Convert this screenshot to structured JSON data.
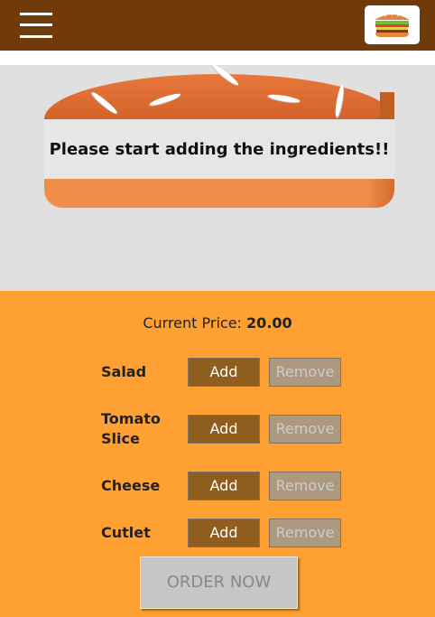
{
  "toolbar": {
    "menu_icon": "hamburger-menu-icon",
    "logo_icon": "burger-logo-icon",
    "background": "#703b09"
  },
  "burger": {
    "message": "Please start adding the ingredients!!"
  },
  "controls": {
    "price_label": "Current Price:",
    "price_value": "20.00",
    "ingredients": [
      {
        "label": "Salad",
        "add": "Add",
        "remove": "Remove"
      },
      {
        "label": "Tomato Slice",
        "add": "Add",
        "remove": "Remove"
      },
      {
        "label": "Cheese",
        "add": "Add",
        "remove": "Remove"
      },
      {
        "label": "Cutlet",
        "add": "Add",
        "remove": "Remove"
      }
    ],
    "order_label": "ORDER NOW",
    "background": "#ffa032"
  }
}
